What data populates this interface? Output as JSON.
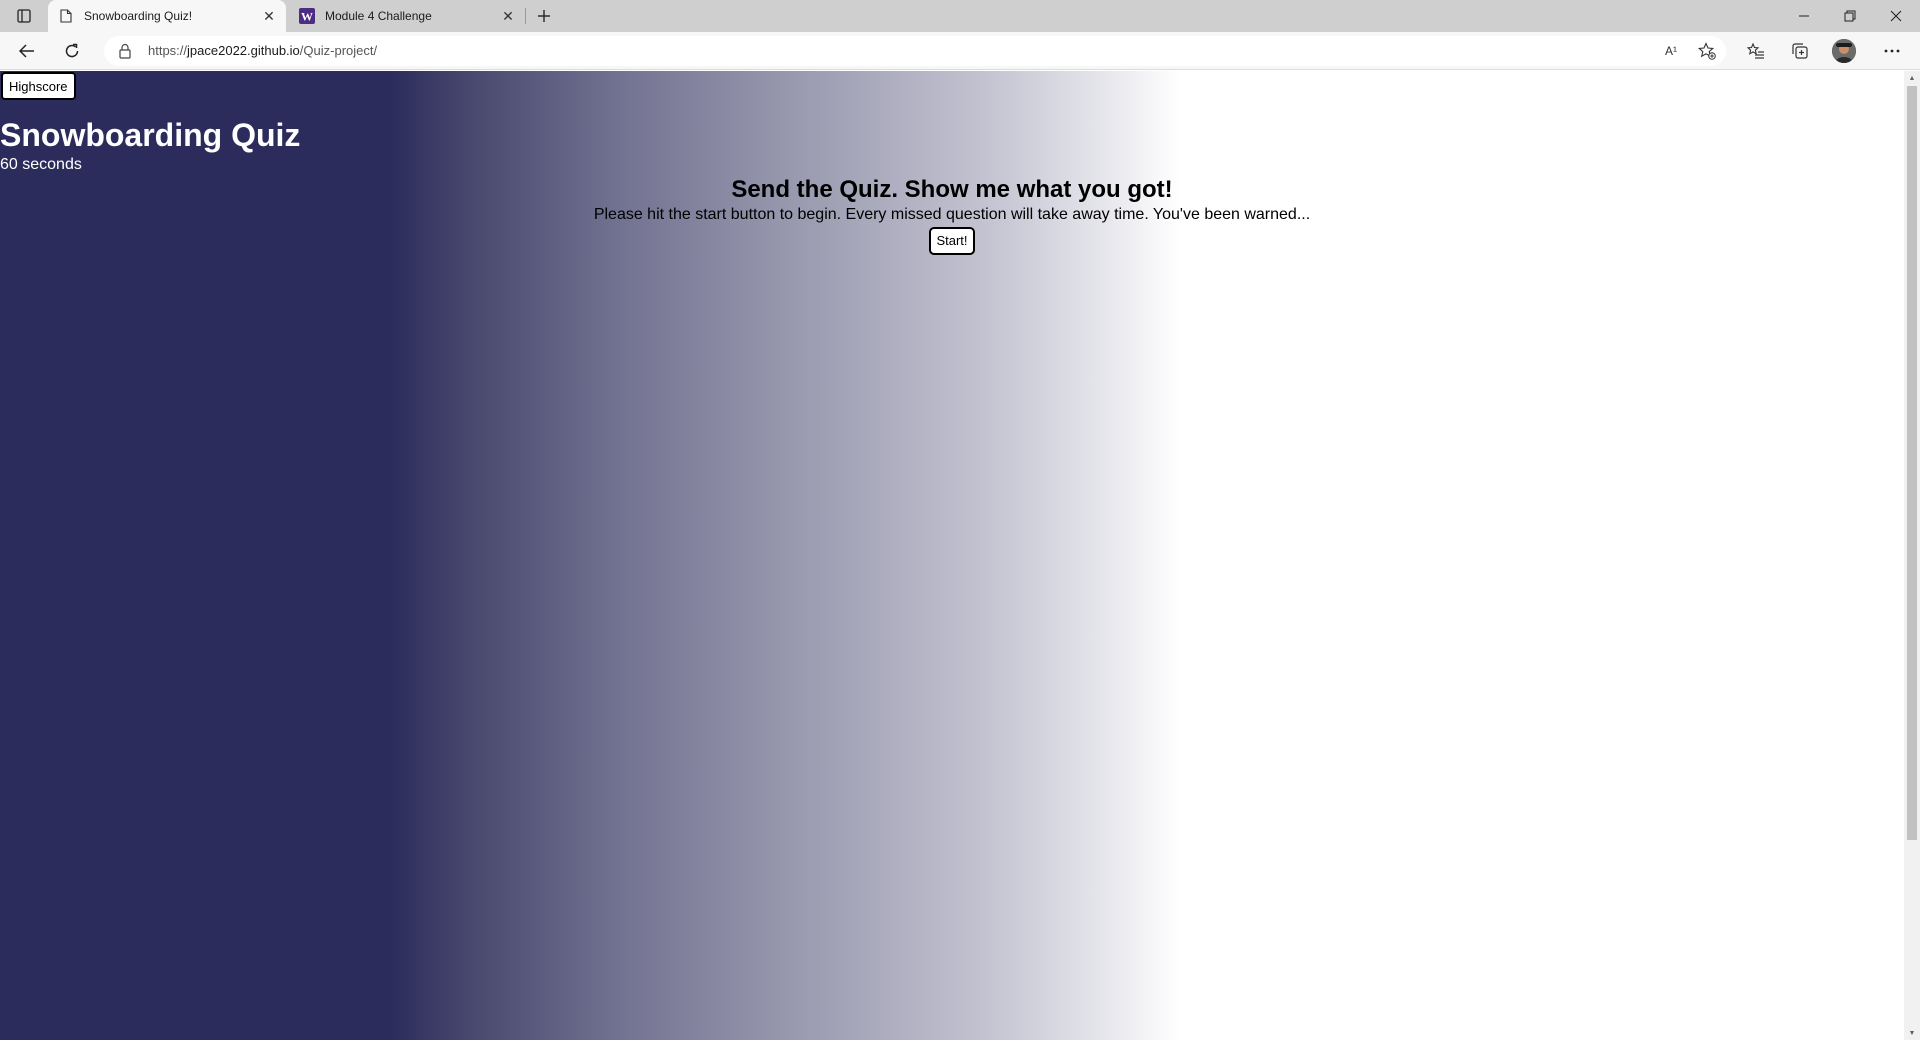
{
  "browser": {
    "tabs": [
      {
        "title": "Snowboarding Quiz!",
        "active": true,
        "icon": "page-icon"
      },
      {
        "title": "Module 4 Challenge",
        "active": false,
        "icon": "w-logo-icon"
      }
    ],
    "address": {
      "scheme": "https://",
      "host": "jpace2022.github.io",
      "path": "/Quiz-project/"
    },
    "read_aloud_label": "A¹"
  },
  "page": {
    "highscore_label": "Highscore",
    "title": "Snowboarding Quiz",
    "timer_text": "60 seconds",
    "headline": "Send the Quiz. Show me what you got!",
    "instructions": "Please hit the start button to begin. Every missed question will take away time. You've been warned...",
    "start_label": "Start!",
    "colors": {
      "gradient_dark": "#2c2c5c",
      "gradient_light": "#ffffff"
    }
  }
}
